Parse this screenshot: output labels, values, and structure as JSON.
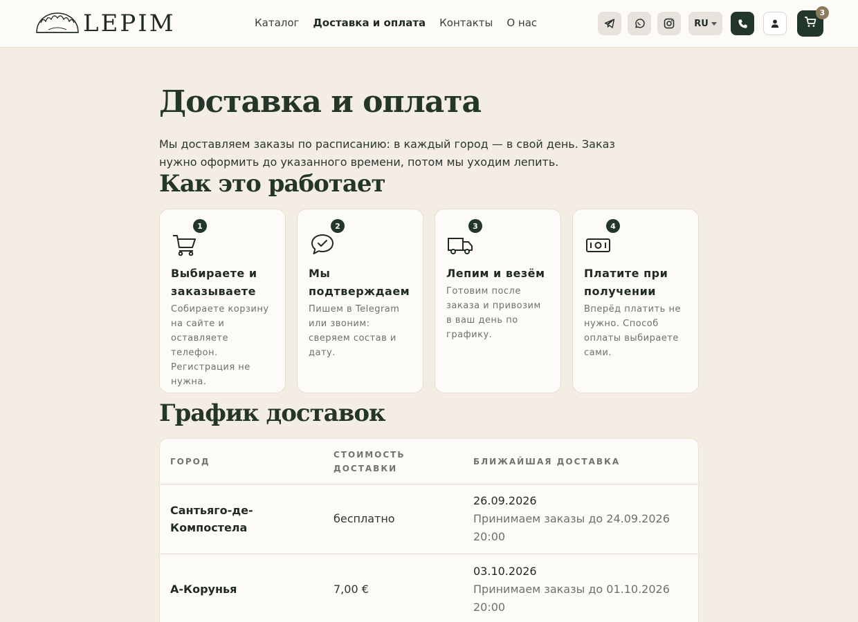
{
  "logo": {
    "text": "LEPIM",
    "icon": "dumpling-icon"
  },
  "nav": {
    "items": [
      {
        "label": "Каталог",
        "active": false
      },
      {
        "label": "Доставка и оплата",
        "active": true
      },
      {
        "label": "Контакты",
        "active": false
      },
      {
        "label": "О нас",
        "active": false
      }
    ]
  },
  "header_actions": {
    "icons": [
      "telegram-icon",
      "whatsapp-icon",
      "instagram-icon"
    ],
    "language": "RU",
    "cart_count": "3"
  },
  "page": {
    "title": "Доставка и оплата",
    "intro": "Мы доставляем заказы по расписанию: в каждый город — в свой день. Заказ нужно оформить до указанного времени, потом мы уходим лепить."
  },
  "how": {
    "title": "Как это работает",
    "steps": [
      {
        "num": "1",
        "icon": "cart-icon",
        "title": "Выбираете и заказываете",
        "desc": "Собираете корзину на сайте и оставляете телефон. Регистрация не нужна."
      },
      {
        "num": "2",
        "icon": "chat-check-icon",
        "title": "Мы подтверждаем",
        "desc": "Пишем в Telegram или звоним: сверяем состав и дату."
      },
      {
        "num": "3",
        "icon": "truck-icon",
        "title": "Лепим и везём",
        "desc": "Готовим после заказа и привозим в ваш день по графику."
      },
      {
        "num": "4",
        "icon": "cash-icon",
        "title": "Платите при получении",
        "desc": "Вперёд платить не нужно. Способ оплаты выбираете сами."
      }
    ]
  },
  "schedule": {
    "title": "График доставок",
    "headers": {
      "city": "Город",
      "cost": "Стоимость доставки",
      "next": "Ближайшая доставка"
    },
    "rows": [
      {
        "city": "Сантьяго-де-Компостела",
        "cost": "бесплатно",
        "date": "26.09.2026",
        "deadline": "Принимаем заказы до 24.09.2026 20:00"
      },
      {
        "city": "А-Корунья",
        "cost": "7,00 €",
        "date": "03.10.2026",
        "deadline": "Принимаем заказы до 01.10.2026 20:00"
      }
    ]
  },
  "colors": {
    "accent": "#22372a",
    "background": "#f3ede3",
    "card": "#fdfbf7",
    "badge": "#8c7a5e"
  }
}
